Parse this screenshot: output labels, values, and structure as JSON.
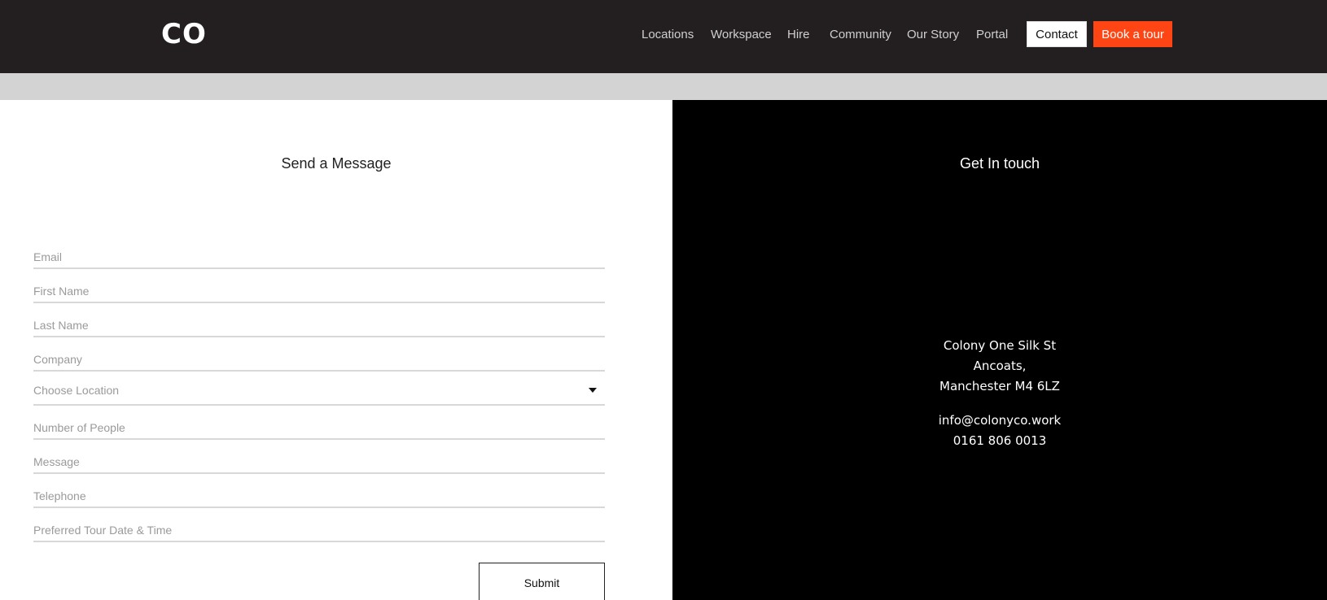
{
  "header": {
    "logo": "CO",
    "nav": [
      "Locations",
      "Workspace",
      "Hire",
      "Community",
      "Our Story",
      "Portal"
    ],
    "contact_label": "Contact",
    "tour_label": "Book a tour",
    "accent_color": "#ff4514",
    "bg_color": "#231f20"
  },
  "form": {
    "title": "Send a Message",
    "fields": {
      "email": "Email",
      "first_name": "First Name",
      "last_name": "Last Name",
      "company": "Company",
      "location": "Choose Location",
      "people": "Number of People",
      "message": "Message",
      "telephone": "Telephone",
      "tour_date": "Preferred Tour Date & Time"
    },
    "submit_label": "Submit"
  },
  "contact": {
    "title": "Get In touch",
    "address": [
      "Colony One Silk St",
      "Ancoats,",
      "Manchester M4 6LZ"
    ],
    "email": "info@colonyco.work",
    "phone": "0161 806 0013"
  }
}
